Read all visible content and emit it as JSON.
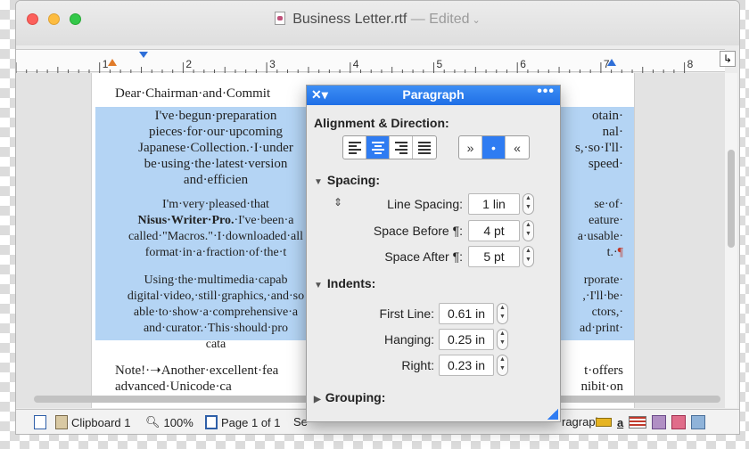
{
  "window": {
    "title": "Business Letter.rtf",
    "edited_label": "— Edited",
    "ruler_numbers": [
      "1",
      "2",
      "3",
      "4",
      "5",
      "6",
      "7",
      "8"
    ]
  },
  "document": {
    "greeting": [
      "Dear·Chairman·and·Commit"
    ],
    "para1": [
      "I've·begun·preparation",
      "pieces·for·our·upcoming",
      "Japanese·Collection.·I·under",
      "be·using·the·latest·version",
      "and·efficien"
    ],
    "para1_right": [
      "otain·",
      "nal·",
      "s,·so·I'll·",
      "speed·",
      ""
    ],
    "para2_left": [
      "I'm·very·pleased·that",
      "Nisus·Writer·Pro.·I've·been·a",
      "called·\"Macros.\"·I·downloaded·all",
      "format·in·a·fraction·of·the·t"
    ],
    "para2_right": [
      "se·of·",
      "eature·",
      "a·usable·",
      "t.·¶"
    ],
    "para3_left": [
      "Using·the·multimedia·capab",
      "digital·video,·still·graphics,·and·so",
      "able·to·show·a·comprehensive·a",
      "and·curator.·This·should·pro",
      "cata"
    ],
    "para3_right": [
      "rporate·",
      ",·I'll·be·",
      "ctors,·",
      "ad·print·",
      ""
    ],
    "para4_left": [
      "Note!·➝Another·excellent·fea",
      "advanced·Unicode·ca"
    ],
    "para4_right": [
      "t·offers",
      "nibit·on"
    ]
  },
  "palette": {
    "title": "Paragraph",
    "close_glyph": "✕▾",
    "more_glyph": "•••",
    "alignment_title": "Alignment & Direction:",
    "direction_buttons": [
      "»",
      "•",
      "«"
    ],
    "spacing_title": "Spacing:",
    "line_spacing_label": "Line Spacing:",
    "line_spacing_value": "1 lin",
    "space_before_label": "Space Before ¶:",
    "space_before_value": "4 pt",
    "space_after_label": "Space After ¶:",
    "space_after_value": "5 pt",
    "indents_title": "Indents:",
    "first_line_label": "First Line:",
    "first_line_value": "0.61 in",
    "hanging_label": "Hanging:",
    "hanging_value": "0.25 in",
    "right_label": "Right:",
    "right_value": "0.23 in",
    "grouping_title": "Grouping:"
  },
  "statusbar": {
    "clipboard": "Clipboard 1",
    "zoom": "100%",
    "page": "Page 1 of 1",
    "section_fragment": "Se",
    "paragraph_fragment": "ragraph:"
  },
  "colors": {
    "selection": "#b4d4f4",
    "accent": "#2f7cf2",
    "pilcrow": "#c0392b"
  }
}
